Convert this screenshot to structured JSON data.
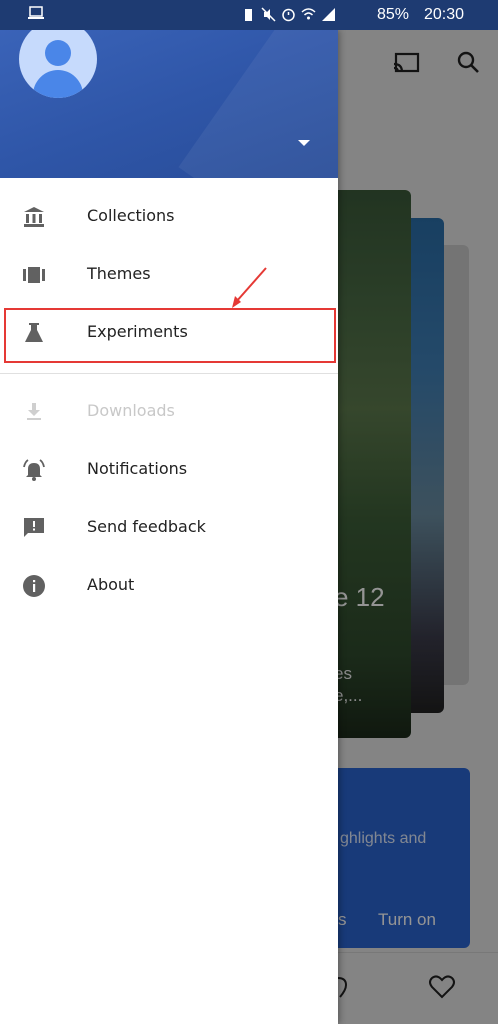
{
  "status_bar": {
    "battery": "85%",
    "time": "20:30"
  },
  "drawer": {
    "menu_primary": [
      {
        "label": "Collections",
        "icon": "collections-icon"
      },
      {
        "label": "Themes",
        "icon": "themes-icon"
      },
      {
        "label": "Experiments",
        "icon": "experiments-icon"
      }
    ],
    "menu_secondary": [
      {
        "label": "Downloads",
        "icon": "download-icon",
        "disabled": true
      },
      {
        "label": "Notifications",
        "icon": "notifications-icon"
      },
      {
        "label": "Send feedback",
        "icon": "feedback-icon"
      },
      {
        "label": "About",
        "icon": "info-icon"
      }
    ],
    "highlighted_item": "Experiments"
  },
  "background_app": {
    "card_number": "e 12",
    "card_text_line1": "es",
    "card_text_line2": "e,...",
    "promo_text": "ghlights and",
    "promo_button_left": "s",
    "promo_button_right": "Turn on"
  },
  "colors": {
    "header_blue": "#2f56a8",
    "highlight_red": "#e53935",
    "icon_gray": "#616161"
  }
}
